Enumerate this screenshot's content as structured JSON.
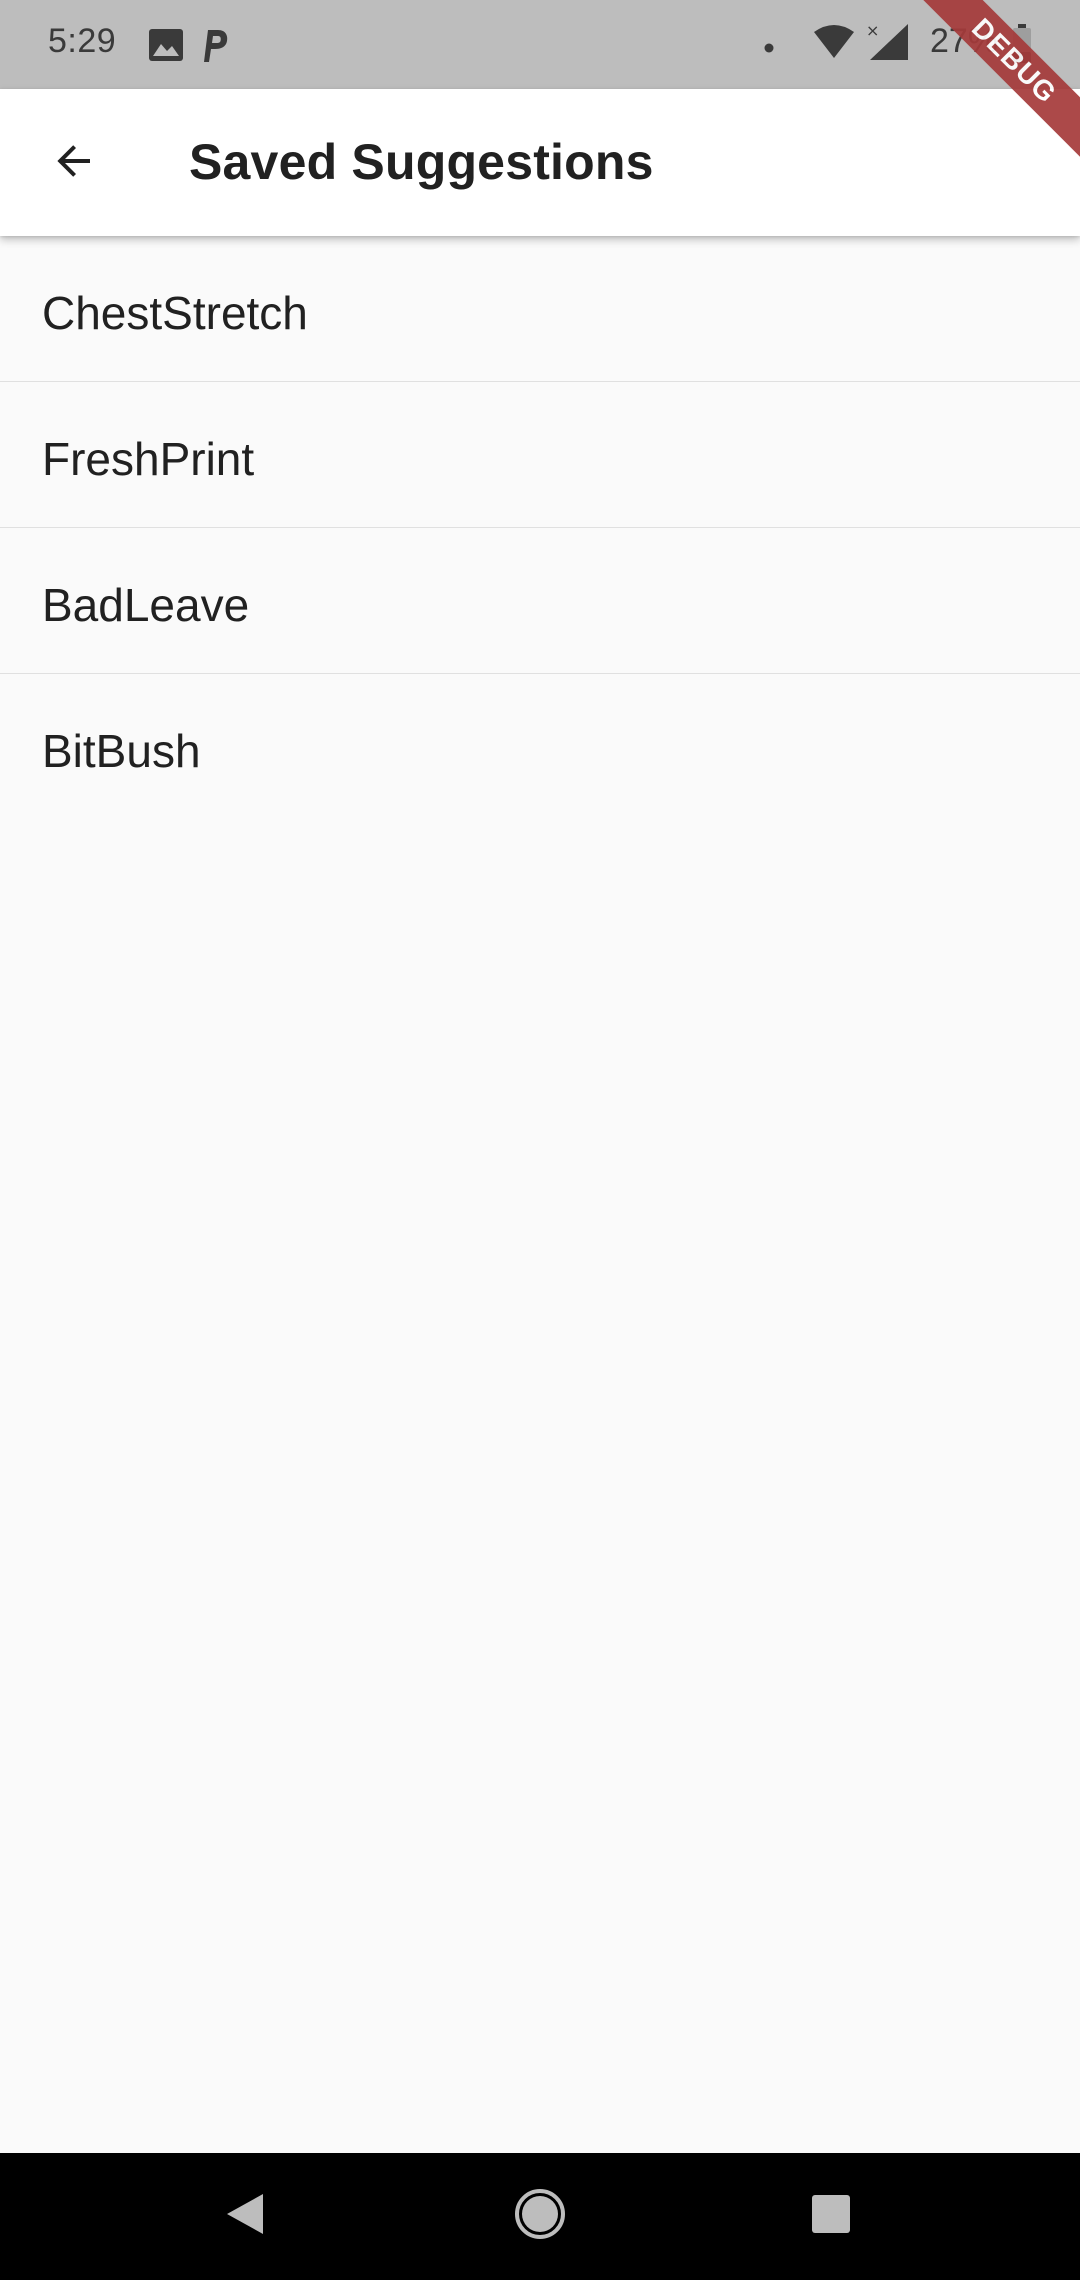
{
  "status_bar": {
    "time": "5:29",
    "battery_text": "27%",
    "icons": [
      "image-icon",
      "parking-icon",
      "notification-dot-icon",
      "wifi-icon",
      "signal-icon",
      "battery-icon"
    ]
  },
  "debug_banner": {
    "label": "DEBUG",
    "color": "#a53a3a"
  },
  "app_bar": {
    "back_icon": "arrow-back-icon",
    "title": "Saved Suggestions"
  },
  "list": {
    "items": [
      {
        "label": "ChestStretch"
      },
      {
        "label": "FreshPrint"
      },
      {
        "label": "BadLeave"
      },
      {
        "label": "BitBush"
      }
    ]
  },
  "nav_bar": {
    "buttons": [
      "back-triangle-icon",
      "home-circle-icon",
      "recents-square-icon"
    ]
  }
}
